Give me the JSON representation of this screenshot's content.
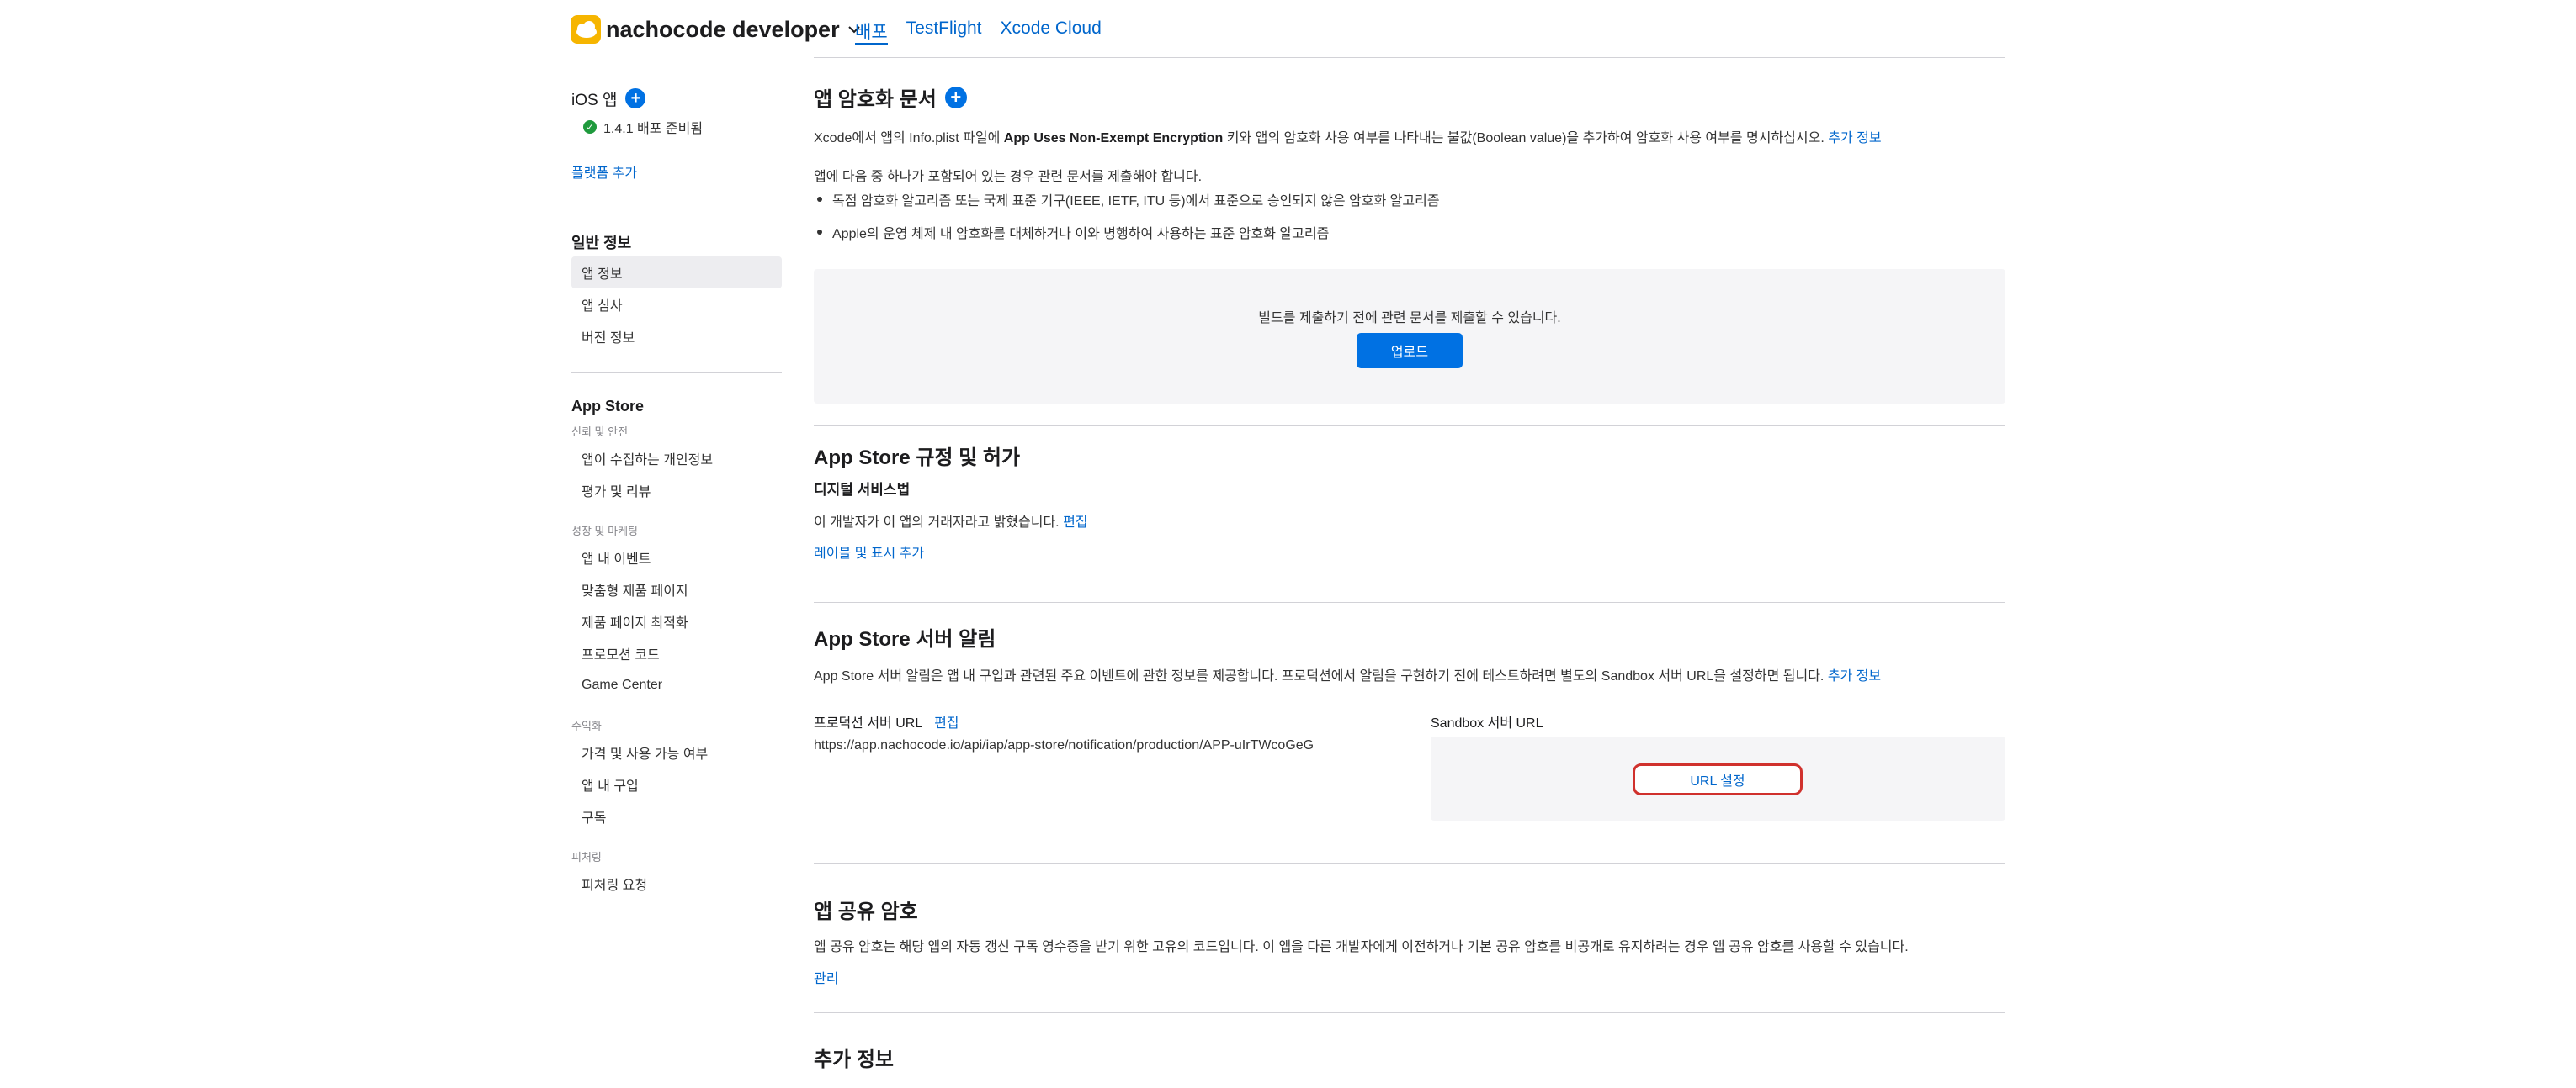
{
  "header": {
    "brand_name": "nachocode developer",
    "nav": [
      {
        "label": "배포",
        "active": true
      },
      {
        "label": "TestFlight",
        "active": false
      },
      {
        "label": "Xcode Cloud",
        "active": false
      }
    ]
  },
  "sidebar": {
    "platform_title": "iOS 앱",
    "status": "1.4.1 배포 준비됨",
    "add_platform": "플랫폼 추가",
    "general_title": "일반 정보",
    "general_items": [
      "앱 정보",
      "앱 심사",
      "버전 정보"
    ],
    "appstore_title": "App Store",
    "group_trust": "신뢰 및 안전",
    "trust_items": [
      "앱이 수집하는 개인정보",
      "평가 및 리뷰"
    ],
    "group_growth": "성장 및 마케팅",
    "growth_items": [
      "앱 내 이벤트",
      "맞춤형 제품 페이지",
      "제품 페이지 최적화",
      "프로모션 코드",
      "Game Center"
    ],
    "group_revenue": "수익화",
    "revenue_items": [
      "가격 및 사용 가능 여부",
      "앱 내 구입",
      "구독"
    ],
    "group_featuring": "피처링",
    "featuring_items": [
      "피처링 요청"
    ]
  },
  "encryption": {
    "title": "앱 암호화 문서",
    "desc_pre": "Xcode에서 앱의 Info.plist 파일에 ",
    "desc_key": "App Uses Non-Exempt Encryption",
    "desc_post": " 키와 앱의 암호화 사용 여부를 나타내는 불값(Boolean value)을 추가하여 암호화 사용 여부를 명시하십시오. ",
    "more_link": "추가 정보",
    "intro": "앱에 다음 중 하나가 포함되어 있는 경우 관련 문서를 제출해야 합니다.",
    "bullets": [
      "독점 암호화 알고리즘 또는 국제 표준 기구(IEEE, IETF, ITU 등)에서 표준으로 승인되지 않은 암호화 알고리즘",
      "Apple의 운영 체제 내 암호화를 대체하거나 이와 병행하여 사용하는 표준 암호화 알고리즘"
    ],
    "upload_hint": "빌드를 제출하기 전에 관련 문서를 제출할 수 있습니다.",
    "upload_button": "업로드"
  },
  "regulation": {
    "title": "App Store 규정 및 허가",
    "sub": "디지털 서비스법",
    "trader_text": "이 개발자가 이 앱의 거래자라고 밝혔습니다. ",
    "edit": "편집",
    "add_label": "레이블 및 표시 추가"
  },
  "notifications": {
    "title": "App Store 서버 알림",
    "desc": "App Store 서버 알림은 앱 내 구입과 관련된 주요 이벤트에 관한 정보를 제공합니다. 프로덕션에서 알림을 구현하기 전에 테스트하려면 별도의 Sandbox 서버 URL을 설정하면 됩니다. ",
    "more_link": "추가 정보",
    "prod_label": "프로덕션 서버 URL",
    "prod_edit": "편집",
    "prod_url": "https://app.nachocode.io/api/iap/app-store/notification/production/APP-uIrTWcoGeG",
    "sandbox_label": "Sandbox 서버 URL",
    "sandbox_button": "URL 설정"
  },
  "shared_secret": {
    "title": "앱 공유 암호",
    "desc": "앱 공유 암호는 해당 앱의 자동 갱신 구독 영수증을 받기 위한 고유의 코드입니다. 이 앱을 다른 개발자에게 이전하거나 기본 공유 암호를 비공개로 유지하려는 경우 앱 공유 암호를 사용할 수 있습니다.",
    "manage": "관리"
  },
  "more_info": {
    "title": "추가 정보"
  }
}
